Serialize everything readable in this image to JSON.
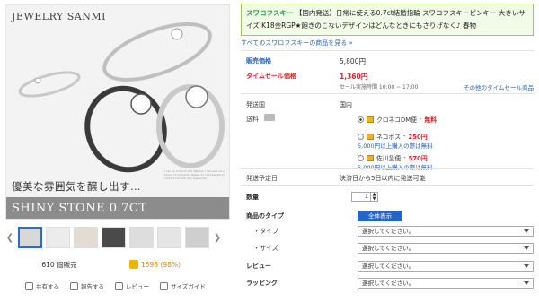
{
  "image": {
    "brand": "JEWELRY SANMI",
    "jp_copy": "優美な雰囲気を醸し出す…",
    "banner": "SHINY STONE 0.7CT",
    "fine_print": "I can be a friend of a lifetime. I can also be a friend of moments. Please do not hesitate to contact me with any questions."
  },
  "thumbnails": {
    "count": 7,
    "active_index": 0
  },
  "stats": {
    "sold": "610 個販売",
    "likes": "1598 (98%)"
  },
  "actions": [
    {
      "label": "共有する",
      "icon": "share-icon"
    },
    {
      "label": "報告する",
      "icon": "report-icon"
    },
    {
      "label": "レビュー",
      "icon": "review-icon"
    },
    {
      "label": "サイズガイド",
      "icon": "ruler-icon"
    }
  ],
  "title": {
    "tag": "スワロフスキー",
    "text": "【国内発送】日常に使える0.7ct結婚指輪 スワロフスキーピンキー 大きいサイズ K18金RGP★飽きのこないデザインはどんなときにもさりげなく♪ 春物"
  },
  "all_link": "すべてのスワロフスキーの商品を見る »",
  "price": {
    "label": "販売価格",
    "value": "5,800円"
  },
  "sale": {
    "label": "タイムセール価格",
    "value": "1,360円",
    "time": "セール実施時間 10:00 ~ 17:00",
    "link": "その他のタイムセール商品"
  },
  "shipping": {
    "origin_label": "発送国",
    "origin_value": "国内",
    "fee_label": "送料",
    "options": [
      {
        "name": "クロネコDM便",
        "price": "無料",
        "note": ""
      },
      {
        "name": "ネコポス",
        "price": "250円",
        "note": "5,000円以上購入の際は無料"
      },
      {
        "name": "佐川急便",
        "price": "570円",
        "note": "5,000円以上購入の際は無料"
      }
    ]
  },
  "ship_date": {
    "label": "発送予定日",
    "value": "決済日から5日以内に発送可能"
  },
  "quantity": {
    "label": "数量",
    "value": "1"
  },
  "product_type": {
    "label": "商品のタイプ",
    "button": "全体表示"
  },
  "options": [
    {
      "label": "・タイプ",
      "value": "選択してください。"
    },
    {
      "label": "・サイズ",
      "value": "選択してください。"
    },
    {
      "label": "レビュー",
      "value": "選択してください。"
    },
    {
      "label": "ラッピング",
      "value": "選択してください。"
    }
  ],
  "colors": {
    "accent_blue": "#2366c9",
    "sale_red": "#d2262e",
    "green_border": "#9ccb5a"
  }
}
